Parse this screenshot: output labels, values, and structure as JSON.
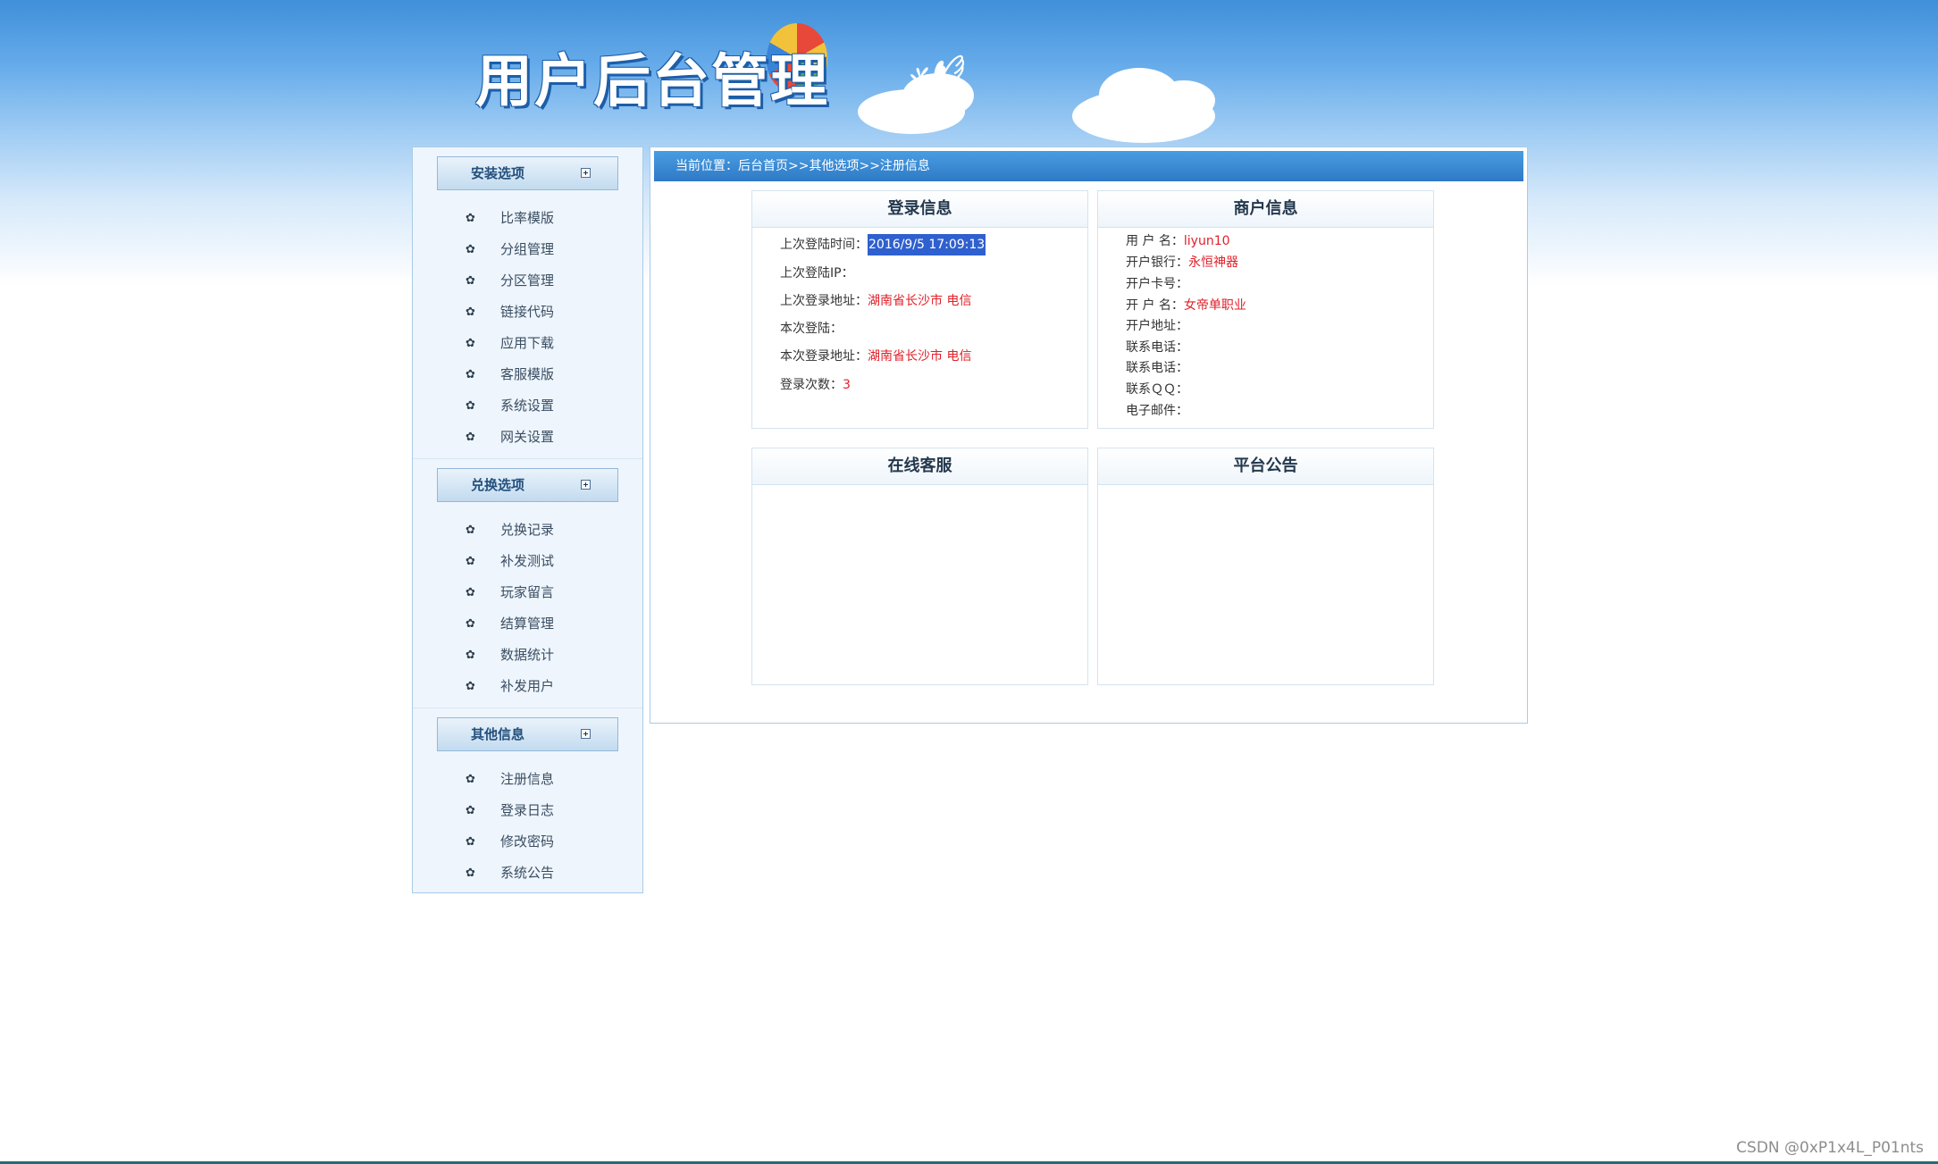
{
  "header": {
    "title": "用户后台管理"
  },
  "sidebar": {
    "sections": [
      {
        "title": "安装选项",
        "items": [
          "比率模版",
          "分组管理",
          "分区管理",
          "链接代码",
          "应用下载",
          "客服模版",
          "系统设置",
          "网关设置"
        ]
      },
      {
        "title": "兑换选项",
        "items": [
          "兑换记录",
          "补发测试",
          "玩家留言",
          "结算管理",
          "数据统计",
          "补发用户"
        ]
      },
      {
        "title": "其他信息",
        "items": [
          "注册信息",
          "登录日志",
          "修改密码",
          "系统公告"
        ]
      }
    ]
  },
  "breadcrumb": {
    "text": "当前位置：后台首页>>其他选项>>注册信息"
  },
  "login_info": {
    "title": "登录信息",
    "last_login_time_label": "上次登陆时间：",
    "last_login_time": "2016/9/5 17:09:13",
    "last_login_ip_label": "上次登陆IP：",
    "last_login_ip": "",
    "last_login_addr_label": "上次登录地址：",
    "last_login_addr": "湖南省长沙市 电信",
    "this_login_label": "本次登陆：",
    "this_login": "",
    "this_login_addr_label": "本次登录地址：",
    "this_login_addr": "湖南省长沙市 电信",
    "login_count_label": "登录次数：",
    "login_count": "3"
  },
  "merchant_info": {
    "title": "商户信息",
    "username_label": "用 户 名：",
    "username": "liyun10",
    "bank_label": "开户银行：",
    "bank": "永恒神器",
    "card_label": "开户卡号：",
    "card": "",
    "account_name_label": "开 户 名：",
    "account_name": "女帝单职业",
    "bank_addr_label": "开户地址：",
    "bank_addr": "",
    "phone1_label": "联系电话：",
    "phone2_label": "联系电话：",
    "qq_label": "联系ＱＱ：",
    "email_label": "电子邮件："
  },
  "online_service": {
    "title": "在线客服"
  },
  "announcement": {
    "title": "平台公告"
  },
  "watermark": "CSDN @0xP1x4L_P01nts"
}
